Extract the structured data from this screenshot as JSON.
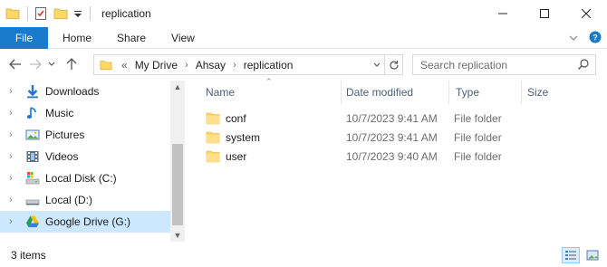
{
  "window": {
    "title": "replication",
    "controls": [
      "minimize-icon",
      "maximize-icon",
      "close-icon"
    ]
  },
  "ribbon": {
    "file": "File",
    "tabs": [
      "Home",
      "Share",
      "View"
    ]
  },
  "address": {
    "overflow": "«",
    "crumbs": [
      "My Drive",
      "Ahsay",
      "replication"
    ]
  },
  "search": {
    "placeholder": "Search replication"
  },
  "sidebar": {
    "items": [
      {
        "label": "Downloads",
        "icon": "downloads-icon"
      },
      {
        "label": "Music",
        "icon": "music-icon"
      },
      {
        "label": "Pictures",
        "icon": "pictures-icon"
      },
      {
        "label": "Videos",
        "icon": "videos-icon"
      },
      {
        "label": "Local Disk (C:)",
        "icon": "drive-c-icon"
      },
      {
        "label": "Local (D:)",
        "icon": "drive-d-icon"
      },
      {
        "label": "Google Drive (G:)",
        "icon": "google-drive-icon",
        "selected": true
      }
    ]
  },
  "columns": {
    "name": "Name",
    "date": "Date modified",
    "type": "Type",
    "size": "Size"
  },
  "files": [
    {
      "name": "conf",
      "date": "10/7/2023 9:41 AM",
      "type": "File folder"
    },
    {
      "name": "system",
      "date": "10/7/2023 9:41 AM",
      "type": "File folder"
    },
    {
      "name": "user",
      "date": "10/7/2023 9:40 AM",
      "type": "File folder"
    }
  ],
  "status": {
    "count": "3 items"
  },
  "colors": {
    "accent": "#1979ca",
    "selection": "#cce8ff",
    "folder": "#ffd866"
  }
}
